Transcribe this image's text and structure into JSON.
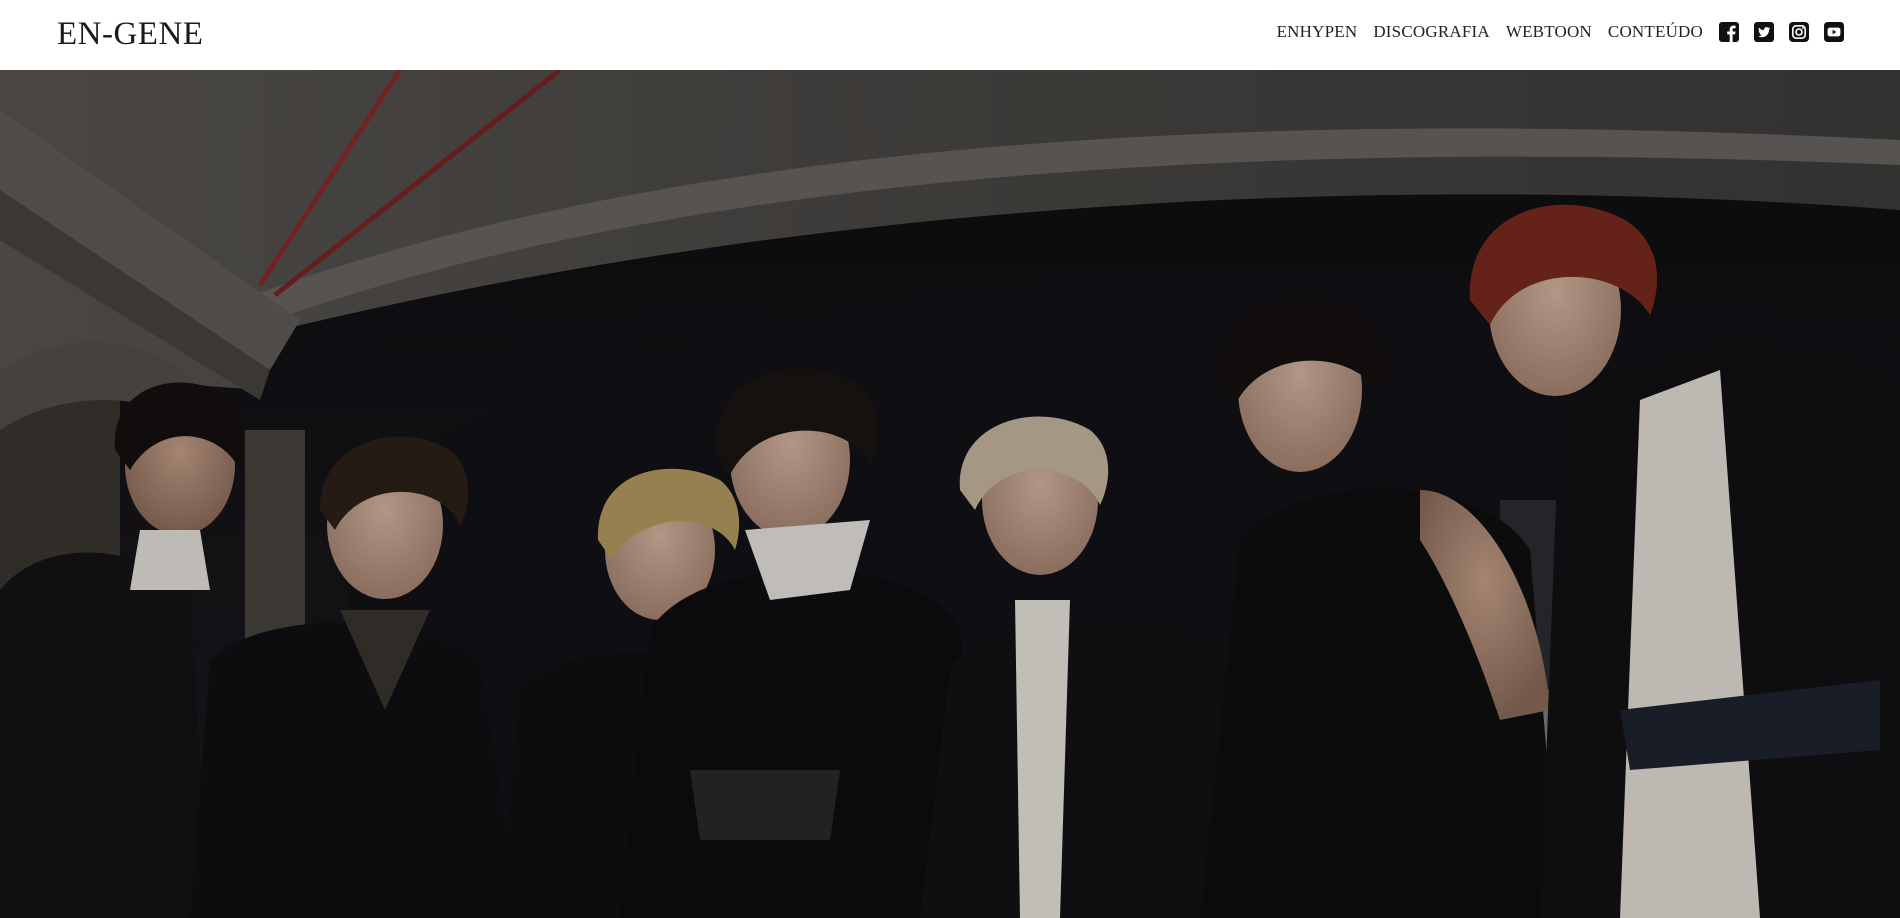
{
  "brand": {
    "name": "EN-GENE"
  },
  "nav": {
    "links": [
      {
        "label": "ENHYPEN"
      },
      {
        "label": "DISCOGRAFIA"
      },
      {
        "label": "WEBTOON"
      },
      {
        "label": "CONTEÚDO"
      }
    ],
    "social": [
      {
        "icon": "facebook-icon"
      },
      {
        "icon": "twitter-icon"
      },
      {
        "icon": "instagram-icon"
      },
      {
        "icon": "youtube-icon"
      }
    ]
  },
  "hero": {
    "image": "group-photo-seven-members-dark-outfits"
  },
  "colors": {
    "nav_bg": "#ffffff",
    "text": "#222222",
    "hero_bg": "#1a1a1c"
  }
}
